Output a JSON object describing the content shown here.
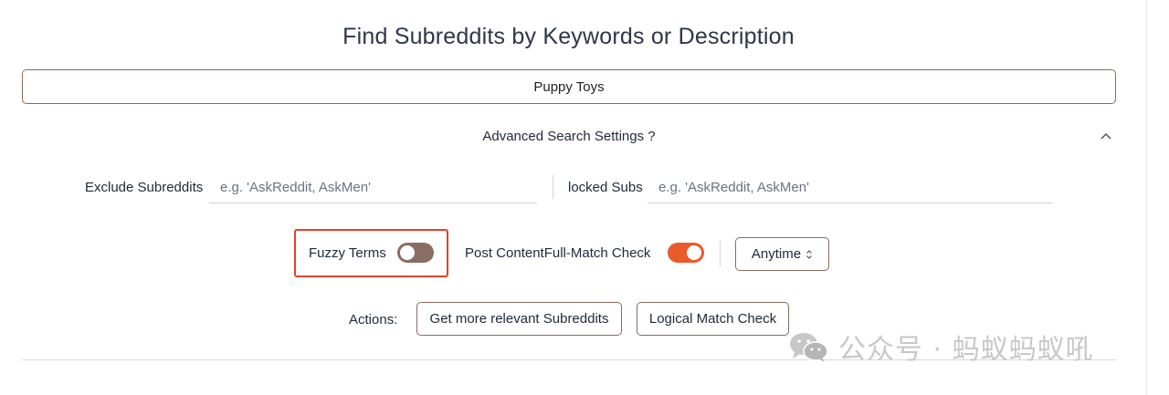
{
  "page": {
    "title": "Find Subreddits by Keywords or Description"
  },
  "search": {
    "value": "Puppy Toys"
  },
  "advanced": {
    "label": "Advanced Search Settings ?",
    "exclude_label": "Exclude Subreddits",
    "exclude_placeholder": "e.g. 'AskReddit, AskMen'",
    "locked_label": "locked Subs",
    "locked_placeholder": "e.g. 'AskReddit, AskMen'"
  },
  "toggles": {
    "fuzzy": {
      "label": "Fuzzy Terms",
      "on": false
    },
    "post_content": {
      "label": "Post ContentFull-Match Check",
      "on": true
    }
  },
  "time_filter": {
    "selected": "Anytime"
  },
  "actions": {
    "label": "Actions:",
    "relevant": "Get more relevant Subreddits",
    "logical": "Logical Match Check"
  },
  "watermark": {
    "text": "公众号 · 蚂蚁蚂蚁吼"
  },
  "colors": {
    "accent_orange": "#ea5a2a",
    "toggle_off": "#8a6d63",
    "border_brown": "#8c6b5e",
    "highlight_red": "#e0442c"
  }
}
